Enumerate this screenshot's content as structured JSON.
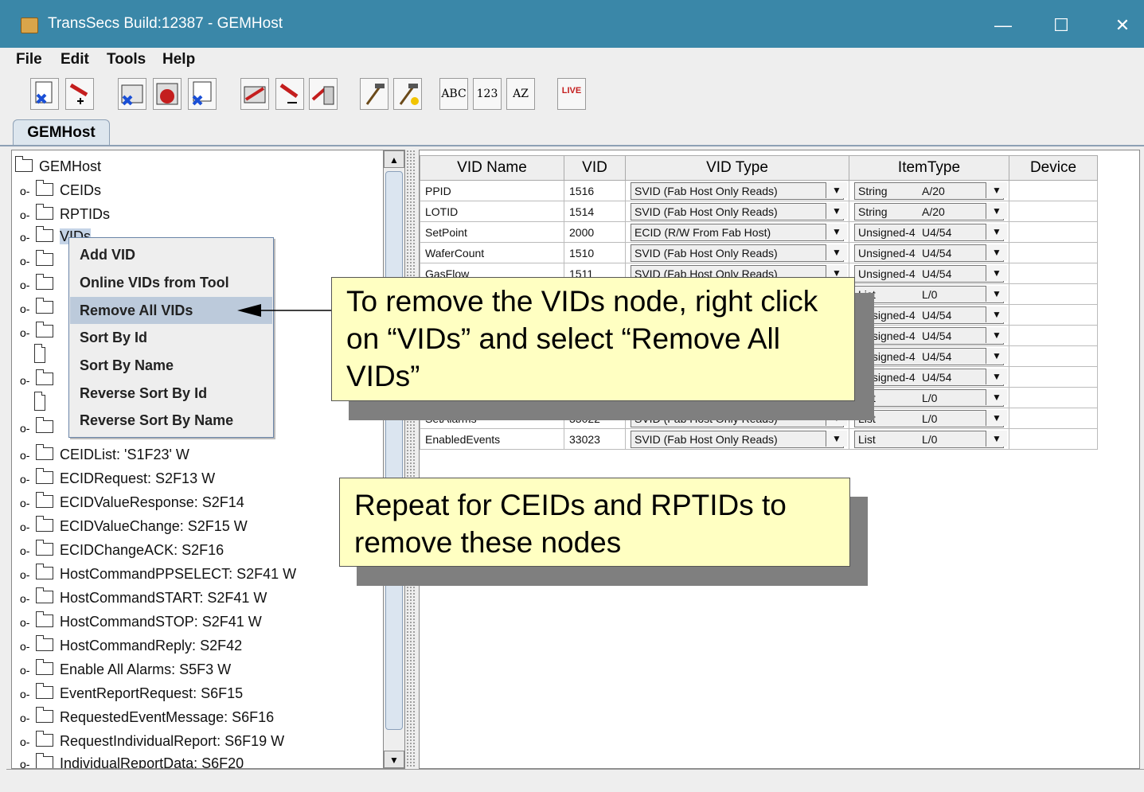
{
  "window": {
    "title": "TransSecs Build:12387 - GEMHost",
    "minimize": "—",
    "maximize": "☐",
    "close": "✕"
  },
  "menubar": {
    "file": "File",
    "edit": "Edit",
    "tools": "Tools",
    "help": "Help"
  },
  "toolbar": {
    "abc": "ABC",
    "num": "123",
    "az": "AZ",
    "live": "LIVE"
  },
  "tabs": {
    "active": "GEMHost"
  },
  "tree": {
    "root": "GEMHost",
    "ceids": "CEIDs",
    "rptids": "RPTIDs",
    "vids": "VIDs",
    "items": [
      "CEIDList: 'S1F23' W",
      "ECIDRequest: S2F13 W",
      "ECIDValueResponse: S2F14",
      "ECIDValueChange: S2F15 W",
      "ECIDChangeACK: S2F16",
      "HostCommandPPSELECT: S2F41 W",
      "HostCommandSTART: S2F41 W",
      "HostCommandSTOP: S2F41 W",
      "HostCommandReply: S2F42",
      "Enable All Alarms: S5F3 W",
      "EventReportRequest: S6F15",
      "RequestedEventMessage: S6F16",
      "RequestIndividualReport: S6F19 W",
      "IndividualReportData: S6F20"
    ]
  },
  "context_menu": {
    "items": [
      "Add VID",
      "Online VIDs from Tool",
      "Remove All VIDs",
      "Sort By Id",
      "Sort By Name",
      "Reverse Sort By Id",
      "Reverse Sort By Name"
    ]
  },
  "table": {
    "headers": [
      "VID Name",
      "VID",
      "VID Type",
      "ItemType",
      "Device"
    ],
    "rows": [
      {
        "name": "PPID",
        "vid": "1516",
        "type": "SVID (Fab Host Only Reads)",
        "item": "String",
        "fmt": "A/20"
      },
      {
        "name": "LOTID",
        "vid": "1514",
        "type": "SVID (Fab Host Only Reads)",
        "item": "String",
        "fmt": "A/20"
      },
      {
        "name": "SetPoint",
        "vid": "2000",
        "type": "ECID (R/W From Fab Host)",
        "item": "Unsigned-4",
        "fmt": "U4/54"
      },
      {
        "name": "WaferCount",
        "vid": "1510",
        "type": "SVID (Fab Host Only Reads)",
        "item": "Unsigned-4",
        "fmt": "U4/54"
      },
      {
        "name": "GasFlow",
        "vid": "1511",
        "type": "SVID (Fab Host Only Reads)",
        "item": "Unsigned-4",
        "fmt": "U4/54"
      },
      {
        "name": "",
        "vid": "",
        "type": "",
        "item": "List",
        "fmt": "L/0"
      },
      {
        "name": "",
        "vid": "",
        "type": "",
        "item": "Unsigned-4",
        "fmt": "U4/54"
      },
      {
        "name": "",
        "vid": "",
        "type": "",
        "item": "Unsigned-4",
        "fmt": "U4/54"
      },
      {
        "name": "",
        "vid": "",
        "type": "",
        "item": "Unsigned-4",
        "fmt": "U4/54"
      },
      {
        "name": "",
        "vid": "",
        "type": "",
        "item": "Unsigned-4",
        "fmt": "U4/54"
      },
      {
        "name": "",
        "vid": "",
        "type": "",
        "item": "List",
        "fmt": "L/0"
      },
      {
        "name": "SetAlarms",
        "vid": "33022",
        "type": "SVID (Fab Host Only Reads)",
        "item": "List",
        "fmt": "L/0"
      },
      {
        "name": "EnabledEvents",
        "vid": "33023",
        "type": "SVID (Fab Host Only Reads)",
        "item": "List",
        "fmt": "L/0"
      }
    ]
  },
  "callouts": {
    "remove_vids": "To remove the VIDs node, right click on “VIDs” and select “Remove All VIDs”",
    "repeat": "Repeat for CEIDs and RPTIDs to remove these nodes"
  }
}
